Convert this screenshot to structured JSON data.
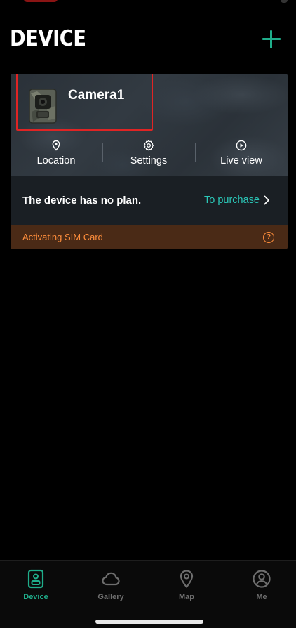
{
  "header": {
    "title": "DEVICE",
    "add_icon": "plus-icon"
  },
  "device": {
    "name": "Camera1",
    "thumbnail_icon": "trail-camera-icon",
    "actions": [
      {
        "label": "Location",
        "icon": "location-pin-icon"
      },
      {
        "label": "Settings",
        "icon": "gear-icon"
      },
      {
        "label": "Live view",
        "icon": "play-circle-icon"
      }
    ],
    "plan": {
      "message": "The device has no plan.",
      "purchase_label": "To purchase"
    },
    "sim": {
      "status": "Activating SIM Card",
      "help_icon": "question-circle-icon"
    }
  },
  "tabs": [
    {
      "label": "Device",
      "icon": "device-icon",
      "active": true
    },
    {
      "label": "Gallery",
      "icon": "cloud-icon",
      "active": false
    },
    {
      "label": "Map",
      "icon": "map-pin-icon",
      "active": false
    },
    {
      "label": "Me",
      "icon": "user-circle-icon",
      "active": false
    }
  ],
  "colors": {
    "accent": "#1fae8b",
    "link": "#2bc7b8",
    "warning": "#ff8e3c",
    "warning_bg": "#4a2a16",
    "highlight": "#e02424"
  }
}
